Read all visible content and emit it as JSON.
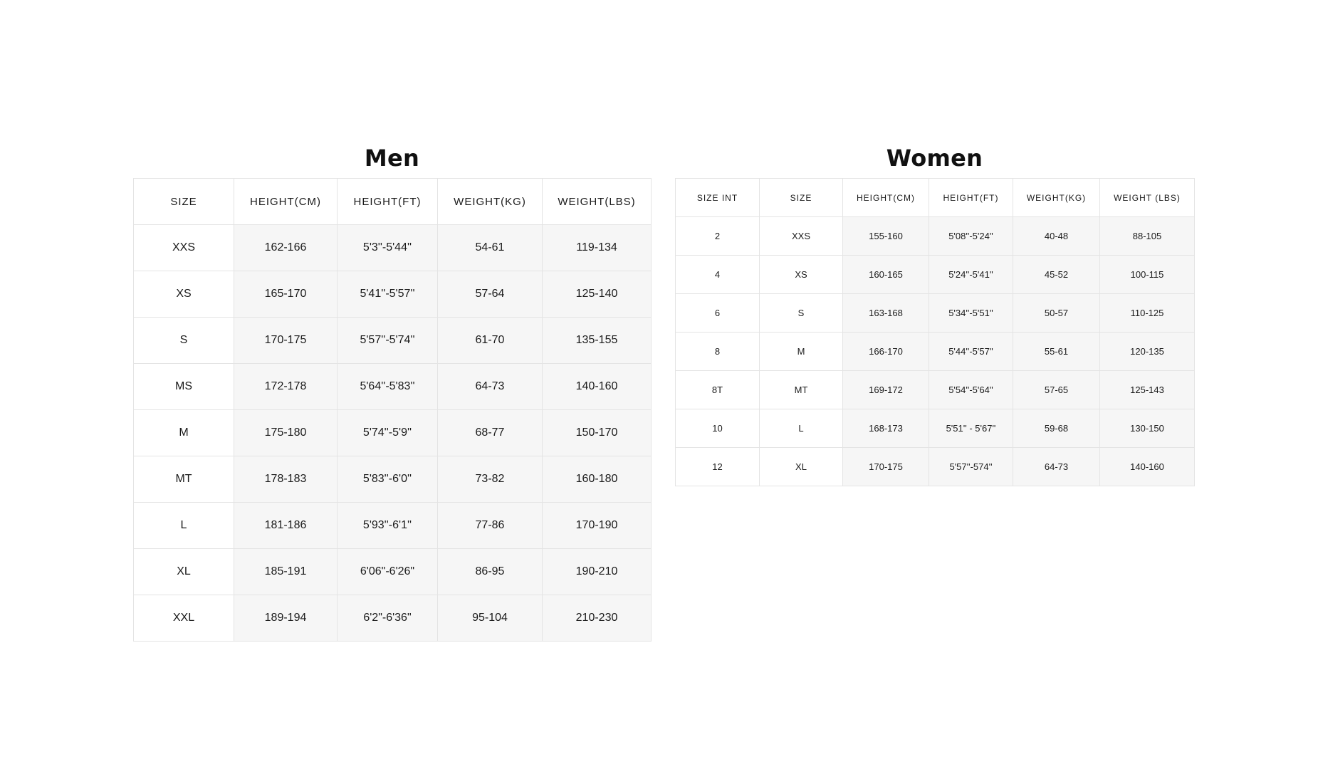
{
  "men": {
    "title": "Men",
    "headers": [
      "SIZE",
      "HEIGHT(CM)",
      "HEIGHT(FT)",
      "WEIGHT(KG)",
      "WEIGHT(LBS)"
    ],
    "rows": [
      [
        "XXS",
        "162-166",
        "5'3''-5'44''",
        "54-61",
        "119-134"
      ],
      [
        "XS",
        "165-170",
        "5'41''-5'57''",
        "57-64",
        "125-140"
      ],
      [
        "S",
        "170-175",
        "5'57''-5'74''",
        "61-70",
        "135-155"
      ],
      [
        "MS",
        "172-178",
        "5'64''-5'83''",
        "64-73",
        "140-160"
      ],
      [
        "M",
        "175-180",
        "5'74''-5'9''",
        "68-77",
        "150-170"
      ],
      [
        "MT",
        "178-183",
        "5'83''-6'0''",
        "73-82",
        "160-180"
      ],
      [
        "L",
        "181-186",
        "5'93''-6'1''",
        "77-86",
        "170-190"
      ],
      [
        "XL",
        "185-191",
        "6'06\"-6'26\"",
        "86-95",
        "190-210"
      ],
      [
        "XXL",
        "189-194",
        "6'2\"-6'36\"",
        "95-104",
        "210-230"
      ]
    ]
  },
  "women": {
    "title": "Women",
    "headers": [
      "SIZE INT",
      "SIZE",
      "HEIGHT(CM)",
      "HEIGHT(FT)",
      "WEIGHT(KG)",
      "WEIGHT (LBS)"
    ],
    "rows": [
      [
        "2",
        "XXS",
        "155-160",
        "5'08''-5'24''",
        "40-48",
        "88-105"
      ],
      [
        "4",
        "XS",
        "160-165",
        "5'24''-5'41''",
        "45-52",
        "100-115"
      ],
      [
        "6",
        "S",
        "163-168",
        "5'34''-5'51''",
        "50-57",
        "110-125"
      ],
      [
        "8",
        "M",
        "166-170",
        "5'44''-5'57''",
        "55-61",
        "120-135"
      ],
      [
        "8T",
        "MT",
        "169-172",
        "5'54''-5'64''",
        "57-65",
        "125-143"
      ],
      [
        "10",
        "L",
        "168-173",
        "5'51'' - 5'67''",
        "59-68",
        "130-150"
      ],
      [
        "12",
        "XL",
        "170-175",
        "5'57''-574''",
        "64-73",
        "140-160"
      ]
    ]
  }
}
